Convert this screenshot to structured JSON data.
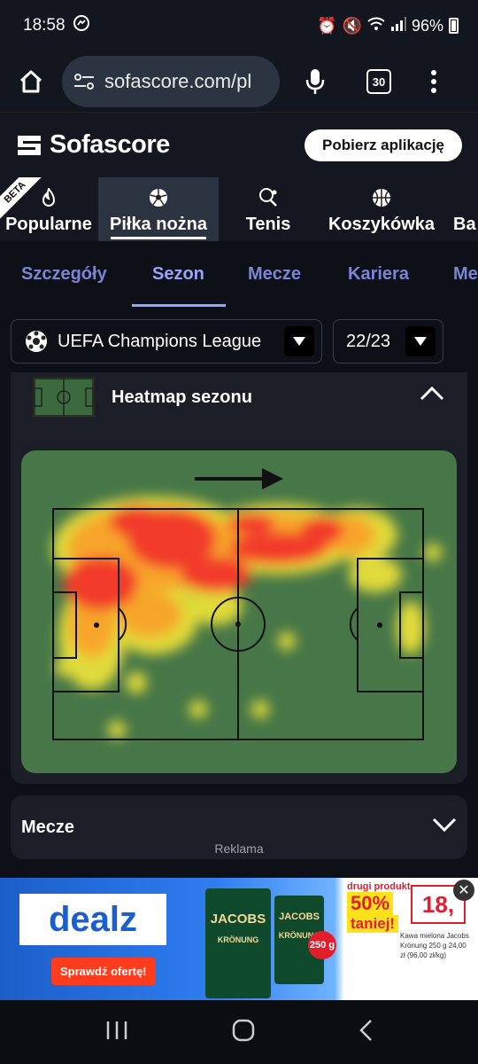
{
  "status_bar": {
    "time": "18:58",
    "battery": "96%"
  },
  "browser": {
    "url": "sofascore.com/pl",
    "tab_count": "30"
  },
  "site": {
    "logo_text": "Sofascore",
    "app_button": "Pobierz aplikację"
  },
  "sport_tabs": [
    {
      "label": "Popularne",
      "badge": "BETA",
      "icon": "flame-icon"
    },
    {
      "label": "Piłka nożna",
      "icon": "football-icon",
      "active": true
    },
    {
      "label": "Tenis",
      "icon": "tennis-icon"
    },
    {
      "label": "Koszykówka",
      "icon": "basketball-icon"
    },
    {
      "label": "Ba"
    }
  ],
  "sub_tabs": [
    "Szczegóły",
    "Sezon",
    "Mecze",
    "Kariera",
    "Me"
  ],
  "sub_tabs_active": "Sezon",
  "filters": {
    "competition": "UEFA Champions League",
    "season": "22/23"
  },
  "heatmap": {
    "title": "Heatmap sezonu",
    "direction": "arrow-right-icon"
  },
  "matches": {
    "title": "Mecze"
  },
  "ad": {
    "label": "Reklama",
    "brand": "dealz",
    "cta": "Sprawdź ofertę!",
    "product_brand": "JACOBS",
    "product_line": "KRÖNUNG",
    "weight_badge": "250 g",
    "promo_top": "drugi produkt",
    "promo_pct": "50%",
    "promo_taniej": "taniej!",
    "price": "18,",
    "promo_small": "Kawa mielona Jacobs Krönung 250 g 24,00 zł (96,00 zł/kg)"
  },
  "colors": {
    "accent": "#98a3ff",
    "pitch": "#477748",
    "heat_hot": "#f23a2a",
    "heat_mid": "#f7a52a",
    "heat_low": "#e8e03a"
  }
}
